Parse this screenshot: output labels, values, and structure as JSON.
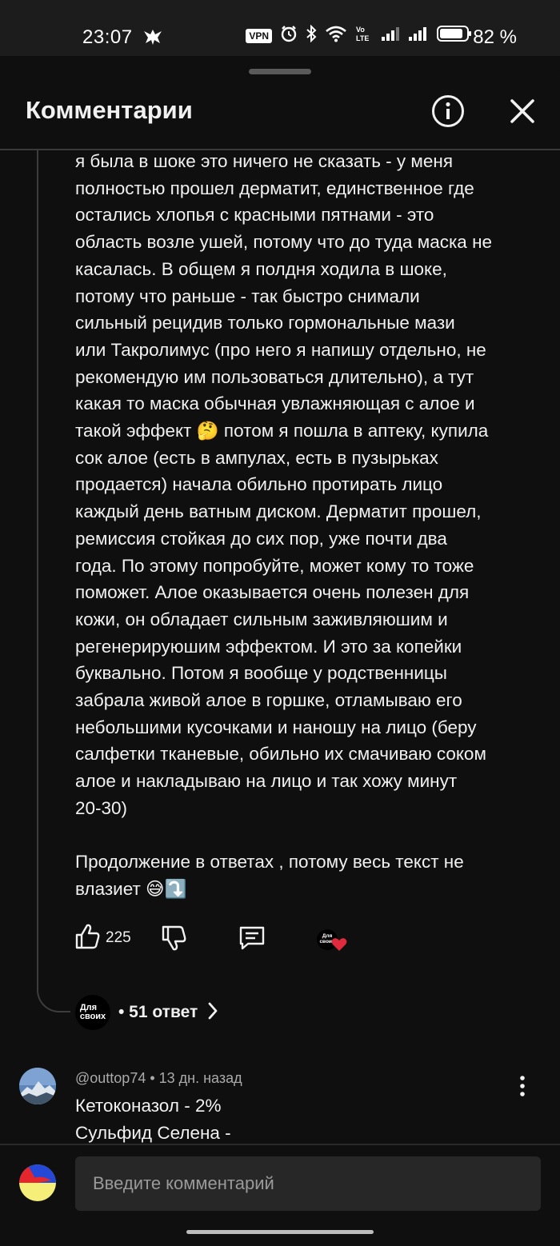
{
  "status_bar": {
    "time": "23:07",
    "vpn": "VPN",
    "battery_percent": "82 %"
  },
  "header": {
    "title": "Комментарии",
    "info_icon": "info-icon",
    "close_icon": "close-icon"
  },
  "comment": {
    "text": "я была в шоке это ничего не сказать - у меня\nполностью прошел дерматит, единственное где\nостались хлопья с красными пятнами - это\nобласть возле ушей, потому что до туда маска не\nкасалась. В общем я полдня ходила в шоке,\nпотому что раньше - так быстро снимали\nсильный рецидив только гормональные мази\nили Такролимус (про него я напишу отдельно, не\nрекомендую им пользоваться длительно), а тут\nкакая то маска обычная увлажняющая с алое и\nтакой эффект 🤔 потом я пошла в аптеку, купила\nсок алое (есть в ампулах, есть в пузырьках\nпродается) начала обильно протирать лицо\nкаждый день ватным диском. Дерматит прошел,\nремиссия стойкая до сих пор, уже почти два\nгода. По этому попробуйте, может кому то тоже\nпоможет. Алое оказывается очень полезен для\nкожи, он обладает сильным заживляюшим и\nрегенерируюшим эффектом. И это за копейки\nбуквально. Потом я вообще у родственницы\nзабрала живой алое в горшке, отламываю его\nнебольшими кусочками и наношу на лицо (беру\nсалфетки тканевые, обильно их смачиваю соком\nалое и накладываю на лицо и так хожу минут\n20-30)\n\nПродолжение в ответах , потому весь текст не\nвлазиет 😅⤵️",
    "like_count": "225",
    "creator_logo_text": "Для своих",
    "replies_label": "• 51 ответ"
  },
  "next_comment": {
    "meta": "@outtop74 • 13 дн. назад",
    "line1": "Кетоконазол - 2%",
    "line2": "Сульфид Селена -"
  },
  "input": {
    "placeholder": "Введите комментарий"
  },
  "colors": {
    "background": "#0f0f0f",
    "input_bg": "#272727",
    "heart": "#e02b3c"
  }
}
